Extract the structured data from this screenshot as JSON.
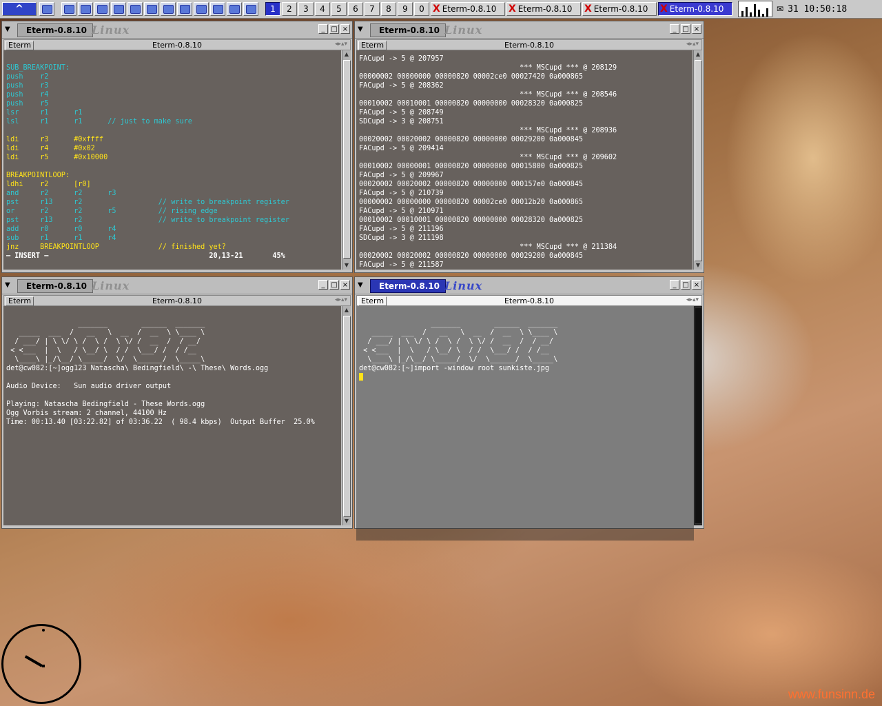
{
  "taskbar": {
    "pager": [
      "1",
      "2",
      "3",
      "4",
      "5",
      "6",
      "7",
      "8",
      "9",
      "0"
    ],
    "active_pager": "1",
    "tasks": [
      "Eterm-0.8.10",
      "Eterm-0.8.10",
      "Eterm-0.8.10",
      "Eterm-0.8.10"
    ],
    "clock": "31  10:50:18",
    "mail_glyph": "✉"
  },
  "windows": {
    "w1": {
      "title": "Eterm-0.8.10",
      "logo": "Linux",
      "menu": "Eterm",
      "center": "Eterm-0.8.10",
      "lines": [
        {
          "t": ""
        },
        {
          "t": "SUB_BREAKPOINT:",
          "c": "cy"
        },
        {
          "t": "push    r2",
          "c": "cy"
        },
        {
          "t": "push    r3",
          "c": "cy"
        },
        {
          "t": "push    r4",
          "c": "cy"
        },
        {
          "t": "push    r5",
          "c": "cy"
        },
        {
          "t": "lsr     r1      r1",
          "c": "cy"
        },
        {
          "t": "lsl     r1      r1      // just to make sure",
          "c": "cy"
        },
        {
          "t": ""
        },
        {
          "t": "ldi     r3      #0xffff",
          "c": "yl"
        },
        {
          "t": "ldi     r4      #0x02",
          "c": "yl"
        },
        {
          "t": "ldi     r5      #0x10000",
          "c": "yl"
        },
        {
          "t": ""
        },
        {
          "t": "BREAKPOINTLOOP:",
          "c": "yl"
        },
        {
          "t": "ldhi    r2      [r0]",
          "c": "yl"
        },
        {
          "t": "and     r2      r2      r3",
          "c": "cy"
        },
        {
          "t": "pst     r13     r2                  // write to breakpoint register",
          "c": "cy"
        },
        {
          "t": "or      r2      r2      r5          // rising edge",
          "c": "cy"
        },
        {
          "t": "pst     r13     r2                  // write to breakpoint register",
          "c": "cy"
        },
        {
          "t": "add     r0      r0      r4",
          "c": "cy"
        },
        {
          "t": "sub     r1      r1      r4",
          "c": "cy"
        },
        {
          "t": "jnz     BREAKPOINTLOOP              // finished yet?",
          "c": "yl"
        },
        {
          "t": "— INSERT —                                      20,13-21       45%",
          "c": "bold"
        }
      ]
    },
    "w2": {
      "title": "Eterm-0.8.10",
      "logo": "Linux",
      "menu": "Eterm",
      "center": "Eterm-0.8.10",
      "lines": [
        {
          "t": "FACupd -> 5 @ 207957"
        },
        {
          "t": "                                      *** MSCupd *** @ 208129"
        },
        {
          "t": "00000002 00000000 00000820 00002ce0 00027420 0a000865"
        },
        {
          "t": "FACupd -> 5 @ 208362"
        },
        {
          "t": "                                      *** MSCupd *** @ 208546"
        },
        {
          "t": "00010002 00010001 00000820 00000000 00028320 0a000825"
        },
        {
          "t": "FACupd -> 5 @ 208749"
        },
        {
          "t": "SDCupd -> 3 @ 208751"
        },
        {
          "t": "                                      *** MSCupd *** @ 208936"
        },
        {
          "t": "00020002 00020002 00000820 00000000 00029200 0a000845"
        },
        {
          "t": "FACupd -> 5 @ 209414"
        },
        {
          "t": "                                      *** MSCupd *** @ 209602"
        },
        {
          "t": "00010002 00000001 00000820 00000000 00015800 0a000825"
        },
        {
          "t": "FACupd -> 5 @ 209967"
        },
        {
          "t": "00020002 00020002 00000820 00000000 000157e0 0a000845"
        },
        {
          "t": "FACupd -> 5 @ 210739"
        },
        {
          "t": "00000002 00000000 00000820 00002ce0 00012b20 0a000865"
        },
        {
          "t": "FACupd -> 5 @ 210971"
        },
        {
          "t": "00010002 00010001 00000820 00000000 00028320 0a000825"
        },
        {
          "t": "FACupd -> 5 @ 211196"
        },
        {
          "t": "SDCupd -> 3 @ 211198"
        },
        {
          "t": "                                      *** MSCupd *** @ 211384"
        },
        {
          "t": "00020002 00020002 00000820 00000000 00029200 0a000845"
        },
        {
          "t": "FACupd -> 5 @ 211587"
        }
      ]
    },
    "w3": {
      "title": "Eterm-0.8.10",
      "logo": "Linux",
      "menu": "Eterm",
      "center": "Eterm-0.8.10",
      "lines": [
        {
          "t": ""
        },
        {
          "t": "                 _______        ______  _______"
        },
        {
          "t": "   _____  ___  /   __   \\  __  /  __  \\ \\____ \\"
        },
        {
          "t": "  / ___/ | \\ \\/ \\ /  \\ /  \\ \\/ /  __  /  / __/"
        },
        {
          "t": " < <___  |  \\   / \\__/ \\  / /  \\___/ /  / /__"
        },
        {
          "t": "  \\____\\ |_/\\__/ \\_____/  \\/  \\______/  \\_____\\"
        },
        {
          "t": "det@cw082:[~]ogg123 Natascha\\ Bedingfield\\ -\\ These\\ Words.ogg"
        },
        {
          "t": ""
        },
        {
          "t": "Audio Device:   Sun audio driver output"
        },
        {
          "t": ""
        },
        {
          "t": "Playing: Natascha Bedingfield - These Words.ogg"
        },
        {
          "t": "Ogg Vorbis stream: 2 channel, 44100 Hz"
        },
        {
          "t": "Time: 00:13.40 [03:22.82] of 03:36.22  ( 98.4 kbps)  Output Buffer  25.0%"
        }
      ]
    },
    "w4": {
      "title": "Eterm-0.8.10",
      "logo": "Linux",
      "menu": "Eterm",
      "center": "Eterm-0.8.10",
      "lines": [
        {
          "t": ""
        },
        {
          "t": "                 _______        ______  _______"
        },
        {
          "t": "   _____  ___  /   __   \\  __  /  __  \\ \\____ \\"
        },
        {
          "t": "  / ___/ | \\ \\/ \\ /  \\ /  \\ \\/ /  __  /  / __/"
        },
        {
          "t": " < <___  |  \\   / \\__/ \\  / /  \\___/ /  / /__"
        },
        {
          "t": "  \\____\\ |_/\\__/ \\_____/  \\/  \\______/  \\_____\\"
        },
        {
          "t": "det@cw082:[~]import -window root sunkiste.jpg"
        }
      ]
    }
  },
  "watermark": "www.funsinn.de"
}
